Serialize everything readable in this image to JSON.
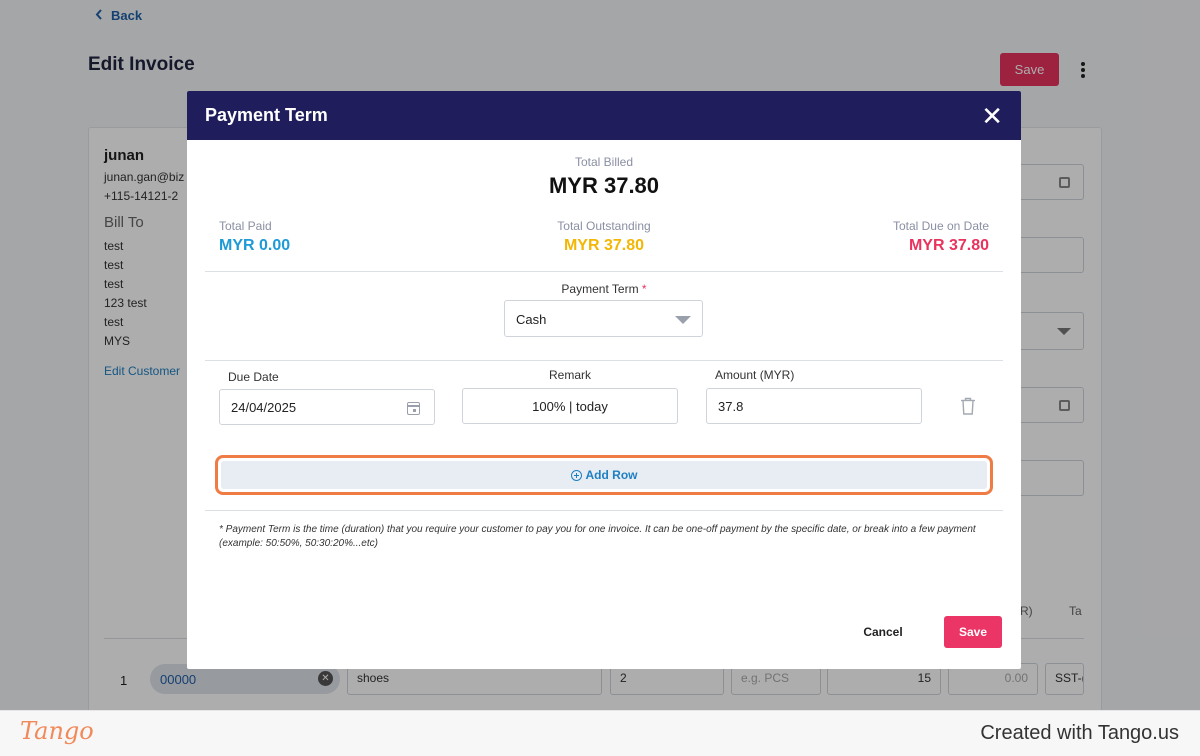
{
  "background": {
    "back_label": "Back",
    "page_title": "Edit Invoice",
    "save_label": "Save",
    "customer": {
      "name": "junan",
      "email": "junan.gan@biz",
      "phone": "+115-14121-2",
      "bill_to_label": "Bill To",
      "address_lines": [
        "test",
        "test",
        "test",
        "123 test",
        "test",
        "MYS"
      ],
      "edit_link": "Edit Customer"
    },
    "col_hints": [
      "R)",
      "Ta"
    ],
    "item_row": {
      "num": "1",
      "code": "00000",
      "description": "shoes",
      "qty": "2",
      "uom_placeholder": "e.g. PCS",
      "price": "15",
      "discount": "0.00",
      "tax": "SST-("
    }
  },
  "modal": {
    "title": "Payment Term",
    "close_symbol": "✕",
    "total_billed_label": "Total Billed",
    "total_billed_value": "MYR 37.80",
    "total_paid_label": "Total Paid",
    "total_paid_value": "MYR 0.00",
    "total_outstanding_label": "Total Outstanding",
    "total_outstanding_value": "MYR 37.80",
    "total_due_label": "Total Due on Date",
    "total_due_value": "MYR 37.80",
    "payment_term_label": "Payment Term",
    "required_mark": "*",
    "payment_term_value": "Cash",
    "columns": {
      "due_date": "Due Date",
      "remark": "Remark",
      "amount": "Amount (MYR)"
    },
    "row": {
      "due_date": "24/04/2025",
      "remark": "100% |  today",
      "amount": "37.8"
    },
    "add_row_label": "Add Row",
    "note_line1": "* Payment Term is the time (duration) that you require your customer to pay you for one invoice. It can be one-off payment by the specific date, or break into a few payment",
    "note_line2": "(example: 50:50%, 50:30:20%...etc)",
    "cancel_label": "Cancel",
    "save_label": "Save"
  },
  "footer": {
    "logo": "Tango",
    "created_with": "Created with Tango.us"
  },
  "colors": {
    "modal_header": "#201d5c",
    "paid": "#1e9ad6",
    "outstanding": "#f2b705",
    "due": "#e8335f",
    "highlight_border": "#f07c45",
    "save_button": "#ea3566"
  }
}
